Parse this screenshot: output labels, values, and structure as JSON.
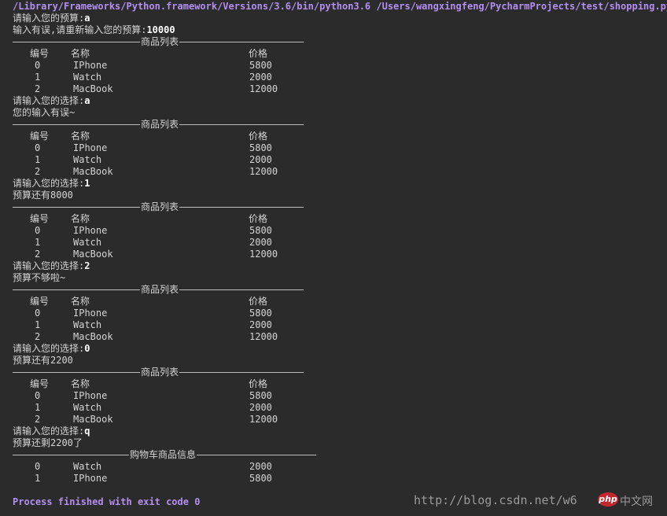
{
  "command": "/Library/Frameworks/Python.framework/Versions/3.6/bin/python3.6 /Users/wangxingfeng/PycharmProjects/test/shopping.py",
  "prompts": {
    "budget": "请输入您的预算:",
    "retry_budget": "输入有误,请重新输入您的预算:",
    "choice": "请输入您的选择:"
  },
  "inputs": {
    "budget_first": "a",
    "budget_second": "10000",
    "choice_1": "a",
    "choice_2": "1",
    "choice_3": "2",
    "choice_4": "0",
    "choice_5": "q"
  },
  "messages": {
    "invalid": "您的输入有误~",
    "remaining_1": "预算还有8000",
    "not_enough": "预算不够啦~",
    "remaining_2": "预算还有2200",
    "final_remaining": "预算还剩2200了"
  },
  "product_list": {
    "title": "商品列表",
    "headers": [
      "编号",
      "名称",
      "价格"
    ],
    "items": [
      {
        "id": "0",
        "name": "IPhone",
        "price": "5800"
      },
      {
        "id": "1",
        "name": "Watch",
        "price": "2000"
      },
      {
        "id": "2",
        "name": "MacBook",
        "price": "12000"
      }
    ]
  },
  "cart": {
    "title": "购物车商品信息",
    "items": [
      {
        "id": "0",
        "name": "Watch",
        "price": "2000"
      },
      {
        "id": "1",
        "name": "IPhone",
        "price": "5800"
      }
    ]
  },
  "exit_message": "Process finished with exit code 0",
  "watermark": {
    "url": "http://blog.csdn.net/w6",
    "logo": "php",
    "site": "中文网"
  },
  "colors": {
    "background": "#2b2b2b",
    "text": "#d4d4d4",
    "command": "#b48ef0",
    "input": "#ffffff"
  }
}
